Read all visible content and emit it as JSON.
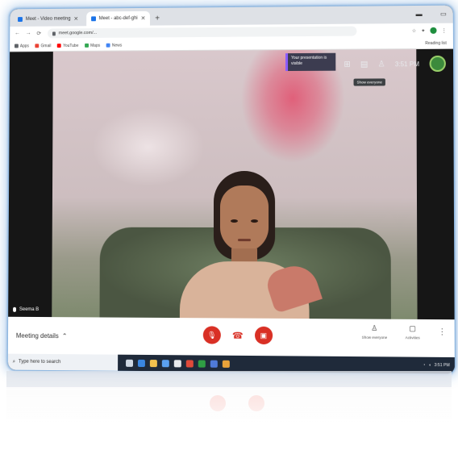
{
  "browser": {
    "tabs": [
      {
        "title": "Meet - Video meeting",
        "active": false
      },
      {
        "title": "Meet - abc-def-ghi",
        "active": true
      }
    ],
    "url": "meet.google.com/...",
    "bookmarks": [
      "Apps",
      "Gmail",
      "YouTube",
      "Maps",
      "News"
    ],
    "reading_list": "Reading list"
  },
  "meet": {
    "presenter_chip": "Your presentation is visible",
    "clock": "3:51 PM",
    "tooltip": "Show everyone",
    "participant_name": "Seema B",
    "meeting_details": "Meeting details",
    "controls": {
      "activities": "Activities",
      "participants": "Show everyone"
    }
  },
  "taskbar": {
    "search_placeholder": "Type here to search",
    "tray_time": "3:51 PM"
  },
  "colors": {
    "accent_red": "#d93025",
    "taskbar": "#1f2a3a",
    "glow": "#2878c8"
  }
}
